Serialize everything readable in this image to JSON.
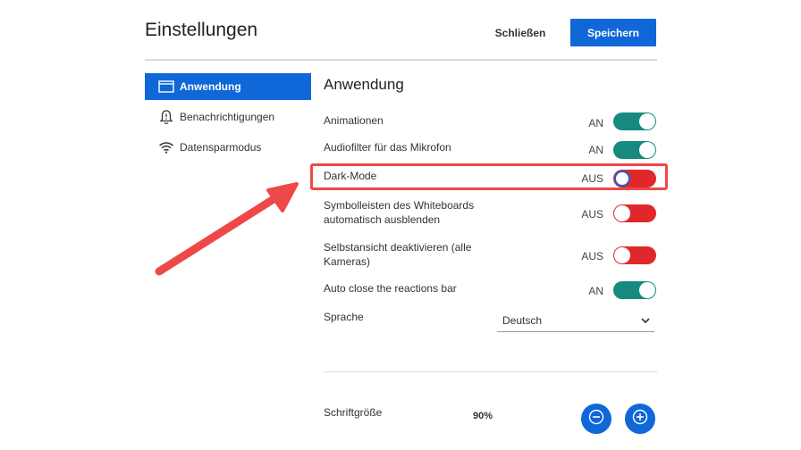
{
  "header": {
    "title": "Einstellungen",
    "close_label": "Schließen",
    "save_label": "Speichern"
  },
  "sidebar": {
    "items": [
      {
        "label": "Anwendung",
        "icon": "window-icon",
        "active": true
      },
      {
        "label": "Benachrichtigungen",
        "icon": "bell-icon",
        "active": false
      },
      {
        "label": "Datensparmodus",
        "icon": "wifi-icon",
        "active": false
      }
    ]
  },
  "main": {
    "section_title": "Anwendung",
    "settings": [
      {
        "label": "Animationen",
        "state": "AN",
        "on": true
      },
      {
        "label": "Audiofilter für das Mikrofon",
        "state": "AN",
        "on": true
      },
      {
        "label": "Dark-Mode",
        "state": "AUS",
        "on": false
      },
      {
        "label": "Symbolleisten des Whiteboards automatisch ausblenden",
        "state": "AUS",
        "on": false
      },
      {
        "label": "Selbstansicht deaktivieren (alle Kameras)",
        "state": "AUS",
        "on": false
      },
      {
        "label": "Auto close the reactions bar",
        "state": "AN",
        "on": true
      }
    ],
    "language": {
      "label": "Sprache",
      "value": "Deutsch"
    },
    "font_size": {
      "label": "Schriftgröße",
      "value": "90%"
    }
  },
  "colors": {
    "accent": "#0f67d8",
    "toggle_on": "#168a7e",
    "toggle_off": "#e0282c",
    "annotation": "#ef4848"
  }
}
